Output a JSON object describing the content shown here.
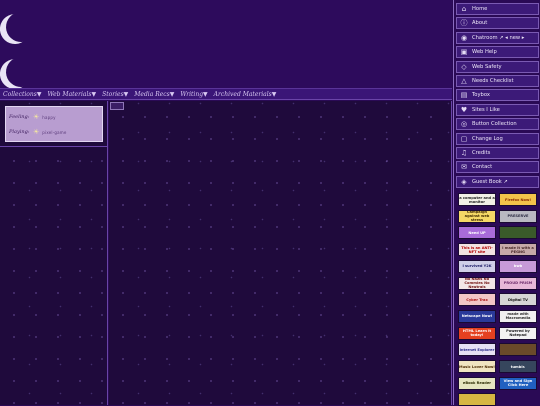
{
  "nav": [
    "Collections▼",
    "Web Materials▼",
    "Stories▼",
    "Media Recs▼",
    "Writing▼",
    "Archived Materials▼"
  ],
  "status": {
    "rows": [
      {
        "label": "Feeling:",
        "icon": "sun-cloud-icon",
        "value": "happy"
      },
      {
        "label": "Playing:",
        "icon": "sun-cloud-icon",
        "value": "pixel-game"
      }
    ]
  },
  "sidebar": {
    "items": [
      {
        "label": "Home",
        "icon": "house-icon",
        "glyph": "⌂"
      },
      {
        "label": "About",
        "icon": "info-icon",
        "glyph": "ⓘ"
      },
      {
        "label": "Chatroom ↗ ◂ new ▸",
        "icon": "chat-icon",
        "glyph": "◉"
      },
      {
        "label": "Web Help",
        "icon": "help-icon",
        "glyph": "▣"
      },
      {
        "label": "Web Safety",
        "icon": "shield-icon",
        "glyph": "◇"
      },
      {
        "label": "Needs Checklist",
        "icon": "warning-icon",
        "glyph": "△"
      },
      {
        "label": "Toybox",
        "icon": "toybox-icon",
        "glyph": "▤"
      },
      {
        "label": "Sites I Like",
        "icon": "heart-icon",
        "glyph": "♥"
      },
      {
        "label": "Button Collection",
        "icon": "button-icon",
        "glyph": "◎"
      },
      {
        "label": "Change Log",
        "icon": "clipboard-icon",
        "glyph": "▢"
      },
      {
        "label": "Credits",
        "icon": "credits-icon",
        "glyph": "♫"
      },
      {
        "label": "Contact",
        "icon": "mail-icon",
        "glyph": "✉"
      },
      {
        "label": "Guest Book ↗",
        "icon": "book-icon",
        "glyph": "◈"
      }
    ]
  },
  "buttons": [
    {
      "text": "a computer and a monitor",
      "bg": "#f2f0e6",
      "fg": "#222"
    },
    {
      "text": "Firefox Now!",
      "bg": "#f3c34a",
      "fg": "#8a2a00"
    },
    {
      "text": "Campaign against web stress",
      "bg": "#f5d866",
      "fg": "#402a00"
    },
    {
      "text": "PRESERVE",
      "bg": "#b9b9c2",
      "fg": "#2c2c44"
    },
    {
      "text": "Need UP",
      "bg": "#a86bd9",
      "fg": "#ffffff"
    },
    {
      "text": "",
      "bg": "#3a5a2a",
      "fg": "#e9f0e0"
    },
    {
      "text": "This is an ANTI-NFT site",
      "bg": "#f2e2e2",
      "fg": "#b00000"
    },
    {
      "text": "I made it with a PEGNG",
      "bg": "#c6a8a8",
      "fg": "#4a2a2a"
    },
    {
      "text": "I survived Y2K",
      "bg": "#d0d0e8",
      "fg": "#1a1a66"
    },
    {
      "text": "bwb",
      "bg": "#c79ad8",
      "fg": "#ffffff"
    },
    {
      "text": "No Nazis No Commies No Neutrals",
      "bg": "#f2e6e6",
      "fg": "#701010"
    },
    {
      "text": "PROUD PRISM",
      "bg": "#e7b8d8",
      "fg": "#6a2a6a"
    },
    {
      "text": "Cyber Trax",
      "bg": "#f2c6c6",
      "fg": "#aa1010"
    },
    {
      "text": "Digital TV",
      "bg": "#d6d6d6",
      "fg": "#101010"
    },
    {
      "text": "Netscape Now!",
      "bg": "#2a3a9a",
      "fg": "#ffffff"
    },
    {
      "text": "made with Macromedia",
      "bg": "#f0f0f0",
      "fg": "#2a2a2a"
    },
    {
      "text": "HTML Learn it today!",
      "bg": "#e44020",
      "fg": "#ffffff"
    },
    {
      "text": "Powered by Notepad",
      "bg": "#f2f2f2",
      "fg": "#222"
    },
    {
      "text": "Internet Explorer",
      "bg": "#e6e0f4",
      "fg": "#2a2a8a"
    },
    {
      "text": "",
      "bg": "#6a4a2a",
      "fg": "#f0e0c0"
    },
    {
      "text": "Music Lover Now!",
      "bg": "#f0e4c0",
      "fg": "#4a2a00"
    },
    {
      "text": "tumblr.",
      "bg": "#36465d",
      "fg": "#ffffff"
    },
    {
      "text": "eBook Reader",
      "bg": "#e6e6c0",
      "fg": "#2a2a00"
    },
    {
      "text": "View and Sign Click Here",
      "bg": "#2060c0",
      "fg": "#ffffff"
    },
    {
      "text": "",
      "bg": "#d6b642",
      "fg": "#2a2000"
    }
  ]
}
